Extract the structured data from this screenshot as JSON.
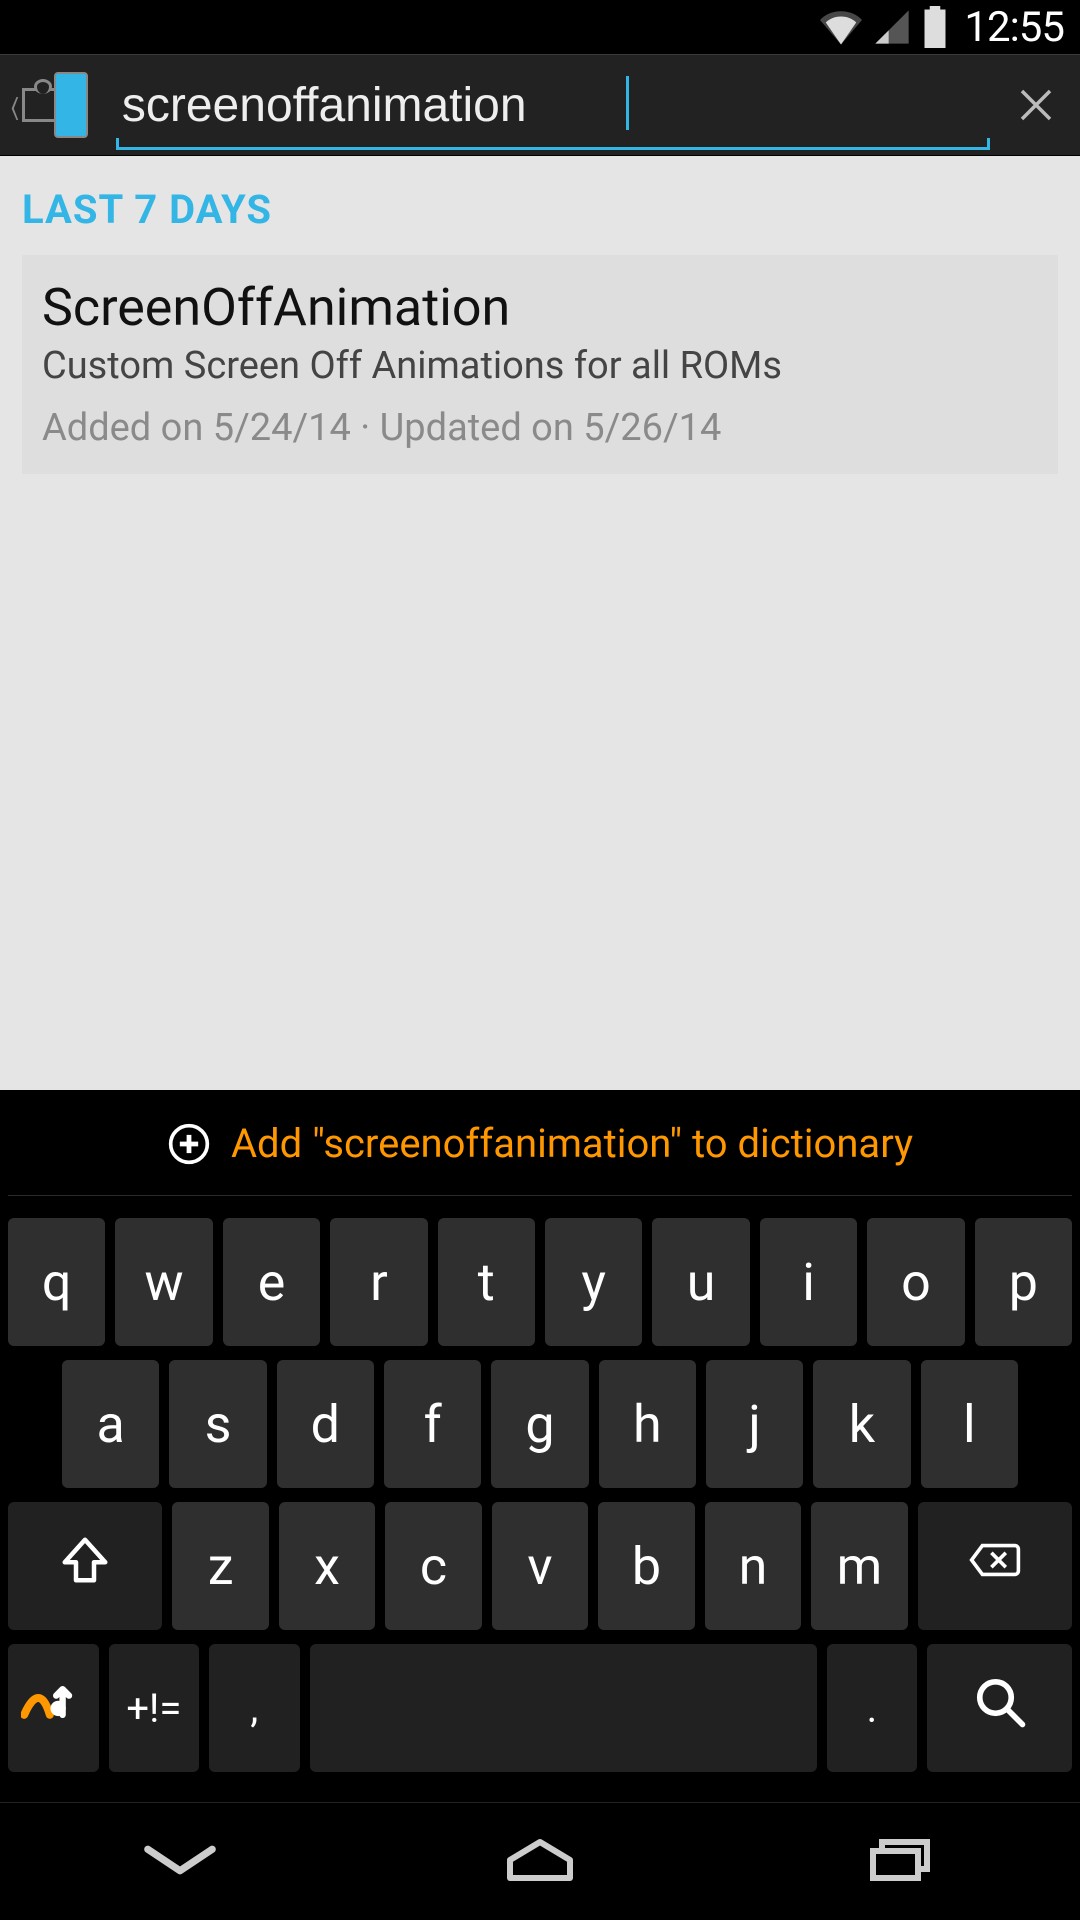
{
  "status": {
    "time": "12:55"
  },
  "search": {
    "value": "screenoffanimation"
  },
  "content": {
    "section_label": "LAST 7 DAYS",
    "results": [
      {
        "title": "ScreenOffAnimation",
        "subtitle": "Custom Screen Off Animations for all ROMs",
        "meta": "Added on 5/24/14 · Updated on 5/26/14"
      }
    ]
  },
  "keyboard": {
    "suggestion": "Add \"screenoffanimation\" to dictionary",
    "row1": [
      "q",
      "w",
      "e",
      "r",
      "t",
      "y",
      "u",
      "i",
      "o",
      "p"
    ],
    "row2": [
      "a",
      "s",
      "d",
      "f",
      "g",
      "h",
      "j",
      "k",
      "l"
    ],
    "row3": [
      "z",
      "x",
      "c",
      "v",
      "b",
      "n",
      "m"
    ],
    "symbols": "+!=",
    "comma": ",",
    "period": "."
  }
}
